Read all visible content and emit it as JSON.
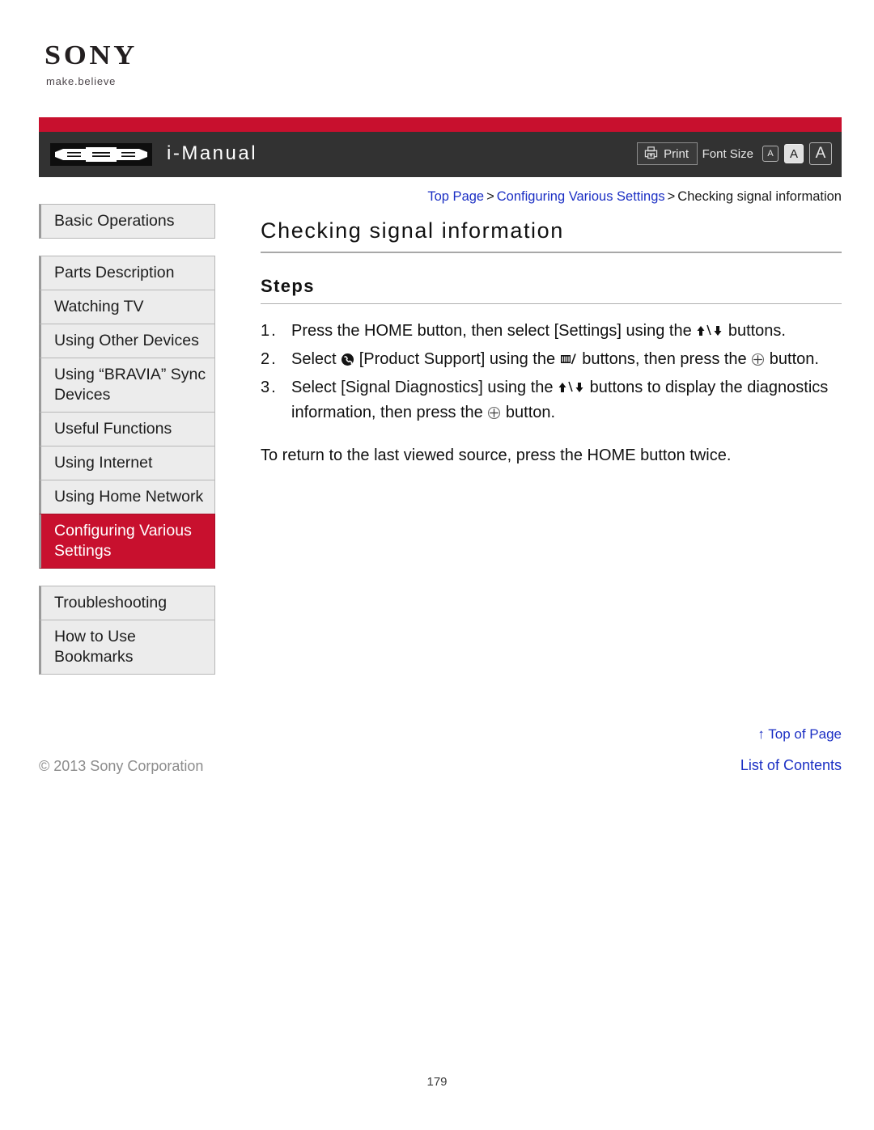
{
  "brand": {
    "name": "SONY",
    "tagline": "make.believe"
  },
  "header": {
    "title": "i-Manual",
    "print_label": "Print",
    "font_size_label": "Font Size",
    "font_sizes": [
      {
        "label": "A",
        "size": "small",
        "selected": false
      },
      {
        "label": "A",
        "size": "medium",
        "selected": true
      },
      {
        "label": "A",
        "size": "large",
        "selected": false
      }
    ],
    "accent_color": "#c8102e",
    "bar_color": "#323232"
  },
  "sidebar": {
    "items": [
      {
        "label": "Basic Operations",
        "active": false,
        "gap_after": true
      },
      {
        "label": "Parts Description",
        "active": false,
        "gap_after": false
      },
      {
        "label": "Watching TV",
        "active": false,
        "gap_after": false
      },
      {
        "label": "Using Other Devices",
        "active": false,
        "gap_after": false
      },
      {
        "label": "Using “BRAVIA” Sync Devices",
        "active": false,
        "gap_after": false
      },
      {
        "label": "Useful Functions",
        "active": false,
        "gap_after": false
      },
      {
        "label": "Using Internet",
        "active": false,
        "gap_after": false
      },
      {
        "label": "Using Home Network",
        "active": false,
        "gap_after": false
      },
      {
        "label": "Configuring Various Settings",
        "active": true,
        "gap_after": true
      },
      {
        "label": "Troubleshooting",
        "active": false,
        "gap_after": false
      },
      {
        "label": "How to Use Bookmarks",
        "active": false,
        "gap_after": false
      }
    ],
    "active_color": "#c8102e"
  },
  "breadcrumb": {
    "items": [
      {
        "label": "Top Page",
        "link": true
      },
      {
        "label": "Configuring Various Settings",
        "link": true
      },
      {
        "label": "Checking signal information",
        "link": false
      }
    ],
    "separator": ">"
  },
  "main": {
    "title": "Checking signal information",
    "section_heading": "Steps",
    "steps": [
      {
        "number": "1.",
        "parts": [
          {
            "type": "text",
            "value": "Press the HOME button, then select [Settings] using the "
          },
          {
            "type": "icon",
            "value": "up-down-arrows-icon"
          },
          {
            "type": "text",
            "value": " buttons."
          }
        ]
      },
      {
        "number": "2.",
        "parts": [
          {
            "type": "text",
            "value": "Select "
          },
          {
            "type": "icon",
            "value": "product-support-icon"
          },
          {
            "type": "text",
            "value": " [Product Support] using the "
          },
          {
            "type": "icon",
            "value": "numeric-slash-icon"
          },
          {
            "type": "text",
            "value": "  buttons, then press the "
          },
          {
            "type": "icon",
            "value": "enter-button-icon"
          },
          {
            "type": "text",
            "value": " button."
          }
        ]
      },
      {
        "number": "3.",
        "parts": [
          {
            "type": "text",
            "value": "Select [Signal Diagnostics] using the "
          },
          {
            "type": "icon",
            "value": "up-down-arrows-icon"
          },
          {
            "type": "text",
            "value": " buttons to display the diagnostics information, then press the "
          },
          {
            "type": "icon",
            "value": "enter-button-icon"
          },
          {
            "type": "text",
            "value": " button."
          }
        ]
      }
    ],
    "note": "To return to the last viewed source, press the HOME button twice."
  },
  "footer": {
    "top_of_page": "Top of Page",
    "top_of_page_arrow": "↑",
    "copyright": "© 2013 Sony Corporation",
    "list_of_contents": "List of Contents",
    "page_number": "179",
    "link_color": "#1b2fc4"
  }
}
